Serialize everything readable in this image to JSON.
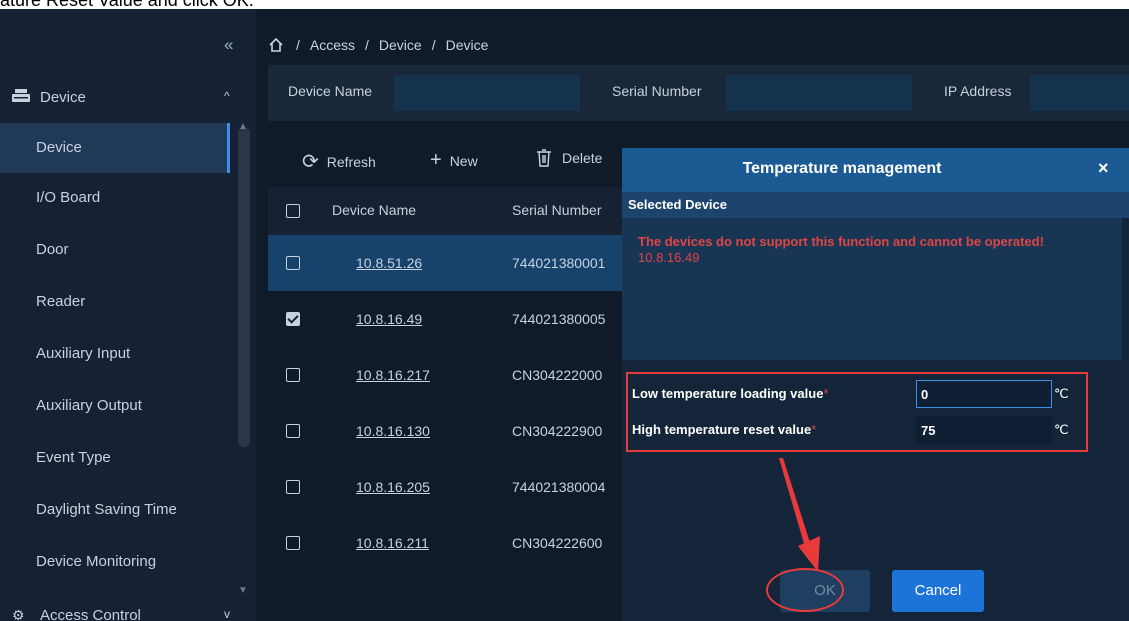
{
  "caption": "ature Reset Value and click OK.",
  "sidebar": {
    "collapse_icon": "«",
    "group1": {
      "label": "Device",
      "icon": "device-icon",
      "chevron": "^"
    },
    "items": [
      {
        "label": "Device",
        "active": true
      },
      {
        "label": "I/O Board"
      },
      {
        "label": "Door"
      },
      {
        "label": "Reader"
      },
      {
        "label": "Auxiliary Input"
      },
      {
        "label": "Auxiliary Output"
      },
      {
        "label": "Event Type"
      },
      {
        "label": "Daylight Saving Time"
      },
      {
        "label": "Device Monitoring"
      }
    ],
    "group2": {
      "label": "Access Control",
      "icon": "gear-icon",
      "chevron": "v"
    }
  },
  "breadcrumb": {
    "items": [
      "Access",
      "Device",
      "Device"
    ],
    "separator": "/"
  },
  "filters": {
    "device_name_label": "Device Name",
    "serial_number_label": "Serial Number",
    "ip_address_label": "IP Address"
  },
  "toolbar": {
    "refresh_label": "Refresh",
    "new_label": "New",
    "delete_label": "Delete"
  },
  "table": {
    "columns": [
      "Device Name",
      "Serial Number"
    ],
    "rows": [
      {
        "name": "10.8.51.26",
        "serial": "744021380001",
        "checked": false,
        "highlight": true
      },
      {
        "name": "10.8.16.49",
        "serial": "744021380005",
        "checked": true
      },
      {
        "name": "10.8.16.217",
        "serial": "CN304222000",
        "checked": false
      },
      {
        "name": "10.8.16.130",
        "serial": "CN304222900",
        "checked": false
      },
      {
        "name": "10.8.16.205",
        "serial": "744021380004",
        "checked": false
      },
      {
        "name": "10.8.16.211",
        "serial": "CN304222600",
        "checked": false
      }
    ]
  },
  "modal": {
    "title": "Temperature management",
    "close_icon": "×",
    "selected_device_label": "Selected Device",
    "error_message": "The devices do not support this function and cannot be operated!",
    "error_device": "10.8.16.49",
    "low_label": "Low temperature loading value",
    "high_label": "High temperature reset value",
    "required_mark": "*",
    "low_value": "0",
    "high_value": "75",
    "unit": "℃",
    "ok_label": "OK",
    "cancel_label": "Cancel"
  },
  "colors": {
    "accent": "#1d74d8",
    "annotation": "#e83a3a",
    "error": "#e04545",
    "highlight_row": "#17426c"
  }
}
